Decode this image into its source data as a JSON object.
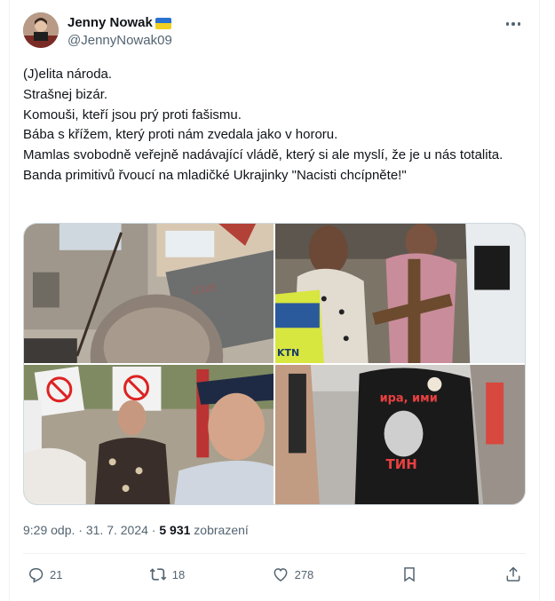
{
  "author": {
    "display_name": "Jenny Nowak",
    "handle": "@JennyNowak09",
    "flag_icon": "ukraine-flag-icon"
  },
  "tweet": {
    "lines": [
      "(J)elita národa.",
      "Strašnej bizár.",
      "Komouši, kteří jsou prý proti fašismu.",
      "Bába s křížem, který proti nám zvedala jako v hororu.",
      "Mamlas svobodně veřejně nadávající vládě, který si ale myslí, že je u nás totalita.",
      "Banda primitivů řvoucí na mladičké Ukrajinky \"Nacisti chcípněte!\""
    ]
  },
  "media": {
    "count": 4,
    "photo_texts": {
      "shirt_top": "ира, ими",
      "shirt_bottom": "ТИН",
      "vest_text": "KTN"
    }
  },
  "meta": {
    "time": "9:29 odp.",
    "separator": "·",
    "date": "31. 7. 2024",
    "views_count": "5 931",
    "views_label": "zobrazení"
  },
  "actions": {
    "replies": "21",
    "reposts": "18",
    "likes": "278"
  },
  "colors": {
    "text": "#0f1419",
    "secondary": "#536471",
    "border": "#eff3f4"
  }
}
